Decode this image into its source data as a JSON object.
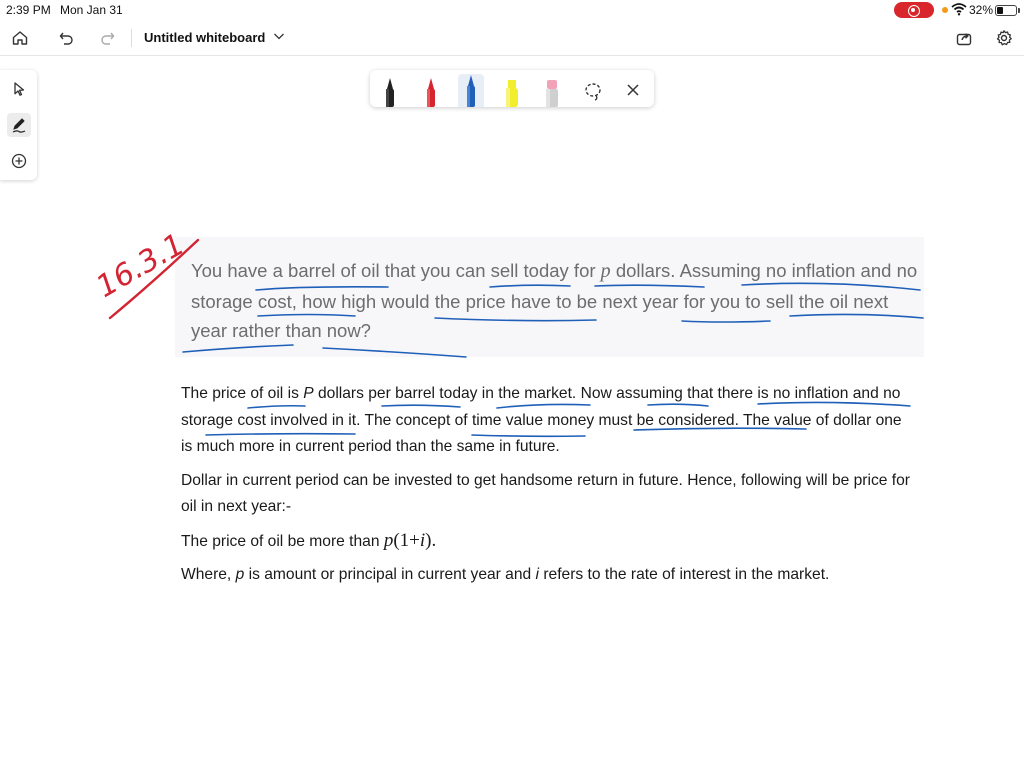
{
  "status_bar": {
    "time": "2:39 PM",
    "date": "Mon Jan 31",
    "battery": "32%",
    "battery_level": 0.32
  },
  "header": {
    "title": "Untitled whiteboard",
    "icons": [
      "home-icon",
      "undo-icon",
      "redo-icon",
      "chevron-down-icon",
      "share-icon",
      "gear-icon"
    ]
  },
  "left_toolbar": {
    "tools": [
      "select-arrow-icon",
      "pen-icon",
      "add-icon"
    ],
    "active": "pen-icon"
  },
  "pen_toolbar": {
    "pens": [
      {
        "name": "black-pen",
        "color": "#222222"
      },
      {
        "name": "red-pen",
        "color": "#d6252f"
      },
      {
        "name": "blue-pen",
        "color": "#1f5fb8"
      },
      {
        "name": "yellow-highlighter",
        "color": "#f2ee2e"
      },
      {
        "name": "eraser",
        "color": "#f2a3b8"
      }
    ],
    "active": "blue-pen",
    "extra_tools": [
      "lasso-icon",
      "close-icon"
    ]
  },
  "ink": {
    "red_note": "16.3.1",
    "red_color": "#d32433",
    "blue_color": "#1f5fb8"
  },
  "question": {
    "text_1": "You have a barrel of oil that you can sell today for",
    "var_p": "p",
    "text_2": "dollars. Assuming no inflation and no storage cost, how high would the price have to be next year for you to sell the oil next year rather than now?"
  },
  "answer": {
    "p1_a": "The price of oil is",
    "p1_var": "P",
    "p1_b": "dollars per barrel today in the market. Now assuming that there is no inflation and no storage cost involved in it. The concept of time value money must be considered. The value of dollar one is much more in current period than the same in future.",
    "p2": "Dollar in current period can be invested to get handsome return in future. Hence, following will be price for oil in next year:-",
    "p3_a": "The price of oil be more than",
    "formula_p": "p",
    "formula_paren_open": "(",
    "formula_one_plus": "1+",
    "formula_i": "i",
    "formula_paren_close": ").",
    "p4_a": "Where,",
    "p4_var_p": "p",
    "p4_b": "is amount or principal in current year and",
    "p4_var_i": "i",
    "p4_c": "refers to the rate of interest in the market."
  }
}
